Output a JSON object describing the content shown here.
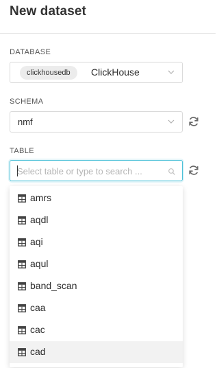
{
  "header": {
    "title": "New dataset"
  },
  "database": {
    "label": "DATABASE",
    "tag": "clickhousedb",
    "name": "ClickHouse"
  },
  "schema": {
    "label": "SCHEMA",
    "value": "nmf"
  },
  "table": {
    "label": "TABLE",
    "search_placeholder": "Select table or type to search ...",
    "search_value": "",
    "options": [
      "amrs",
      "aqdl",
      "aqi",
      "aqul",
      "band_scan",
      "caa",
      "cac",
      "cad"
    ],
    "highlighted_option": "cad"
  },
  "colors": {
    "focus_border": "#45bed6",
    "highlight_row": "#f2f2f2",
    "divider": "#e3e3e3"
  },
  "icons": {
    "select_chevron": "chevron-down-icon",
    "refresh": "refresh-icon",
    "search": "search-icon",
    "table": "table-icon"
  }
}
